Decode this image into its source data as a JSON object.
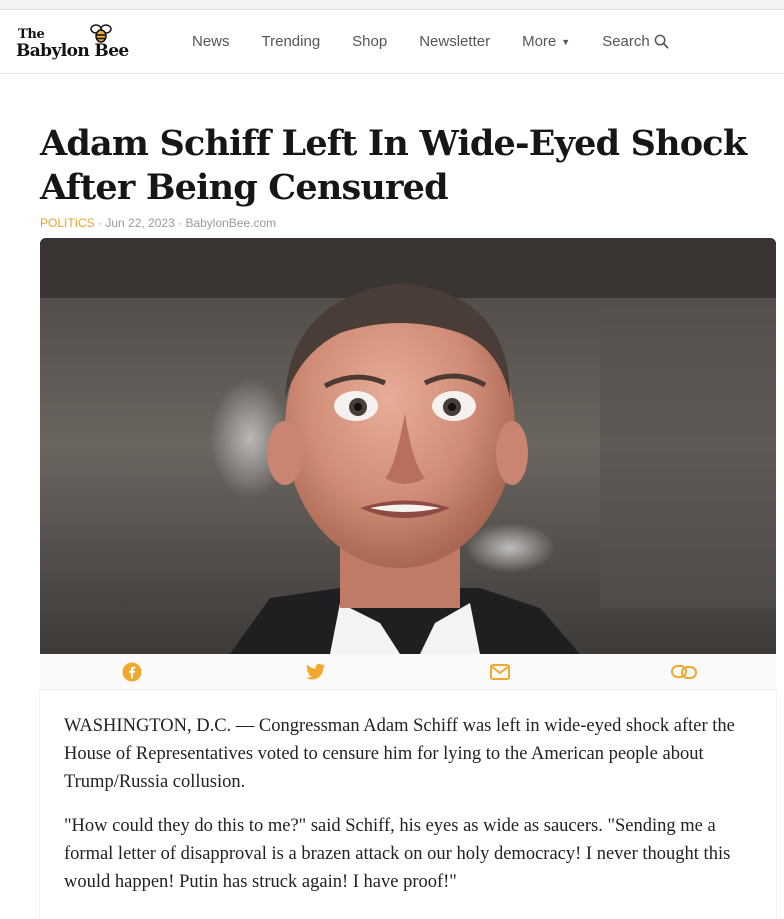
{
  "brand": {
    "the": "The",
    "name": "Babylon Bee"
  },
  "nav": {
    "items": [
      {
        "label": "News"
      },
      {
        "label": "Trending"
      },
      {
        "label": "Shop"
      },
      {
        "label": "Newsletter"
      },
      {
        "label": "More"
      },
      {
        "label": "Search"
      }
    ]
  },
  "article": {
    "title": "Adam Schiff Left In Wide-Eyed Shock After Being Censured",
    "category": "POLITICS",
    "date": "Jun 22, 2023",
    "source": "BabylonBee.com",
    "separator": " · ",
    "paragraphs": [
      "WASHINGTON, D.C. — Congressman Adam Schiff was left in wide-eyed shock after the House of Representatives voted to censure him for lying to the American people about Trump/Russia collusion.",
      "\"How could they do this to me?\" said Schiff, his eyes as wide as saucers. \"Sending me a formal letter of disapproval is a brazen attack on our holy democracy! I never thought this would happen! Putin has struck again! I have proof!\""
    ]
  },
  "share": {
    "icons": [
      "facebook-icon",
      "twitter-icon",
      "email-icon",
      "link-icon"
    ],
    "color": "#f0a830"
  },
  "colors": {
    "accent": "#e8a42b",
    "text": "#161616",
    "muted": "#9a9a9a"
  }
}
